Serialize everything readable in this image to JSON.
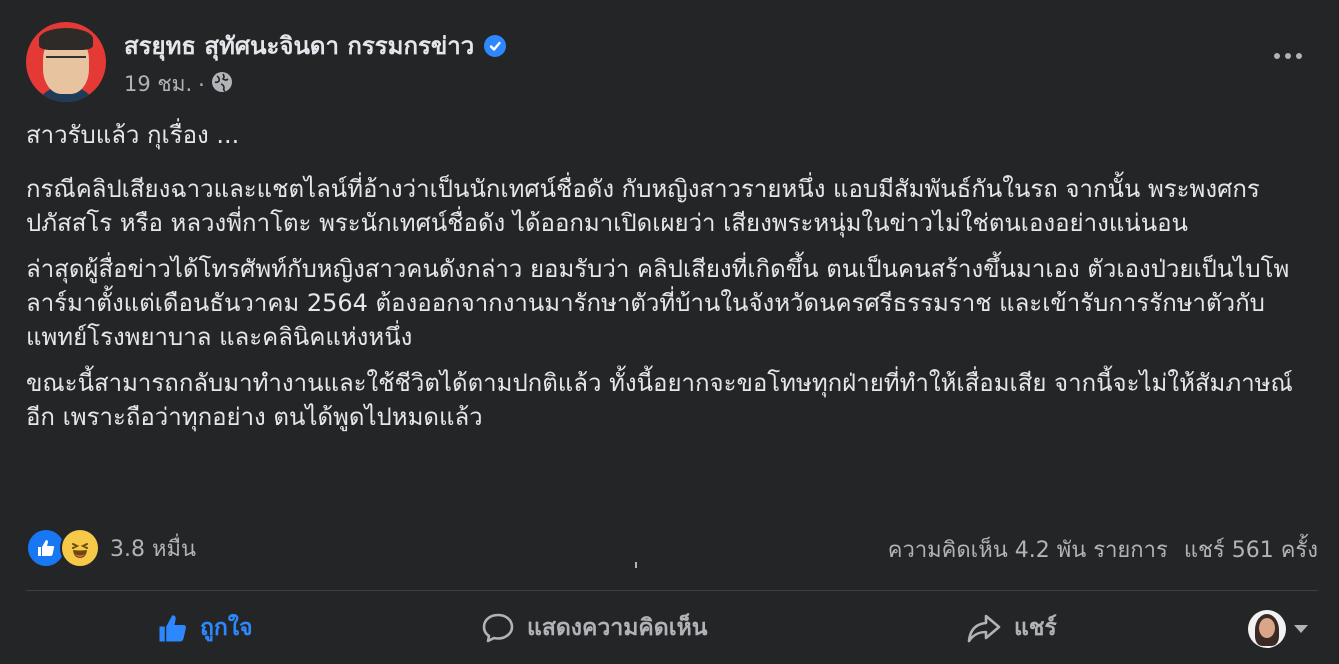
{
  "post": {
    "author": "สรยุทธ สุทัศนะจินดา กรรมกรข่าว",
    "time": "19 ชม.",
    "separator": "·",
    "paragraphs": [
      "สาวรับแล้ว กุเรื่อง ...",
      "กรณีคลิปเสียงฉาวและแชตไลน์ที่อ้างว่าเป็นนักเทศน์ชื่อดัง กับหญิงสาวรายหนึ่ง แอบมีสัมพันธ์กันในรถ จากนั้น พระพงศกร ปภัสสโร หรือ หลวงพี่กาโตะ พระนักเทศน์ชื่อดัง ได้ออกมาเปิดเผยว่า เสียงพระหนุ่มในข่าวไม่ใช่ตนเองอย่างแน่นอน",
      "ล่าสุดผู้สื่อข่าวได้โทรศัพท์กับหญิงสาวคนดังกล่าว ยอมรับว่า คลิปเสียงที่เกิดขึ้น ตนเป็นคนสร้างขึ้นมาเอง ตัวเองป่วยเป็นไบโพลาร์มาตั้งแต่เดือนธันวาคม 2564 ต้องออกจากงานมารักษาตัวที่บ้านในจังหวัดนครศรีธรรมราช และเข้ารับการรักษาตัวกับแพทย์โรงพยาบาล และคลินิคแห่งหนึ่ง",
      "ขณะนี้สามารถกลับมาทำงานและใช้ชีวิตได้ตามปกติแล้ว ทั้งนี้อยากจะขอโทษทุกฝ่ายที่ทำให้เสื่อมเสีย จากนี้จะไม่ให้สัมภาษณ์อีก เพราะถือว่าทุกอย่าง ตนได้พูดไปหมดแล้ว"
    ]
  },
  "stats": {
    "reactions_count": "3.8 หมื่น",
    "comments": "ความคิดเห็น 4.2 พัน รายการ",
    "shares": "แชร์ 561 ครั้ง"
  },
  "actions": {
    "like": "ถูกใจ",
    "comment": "แสดงความคิดเห็น",
    "share": "แชร์"
  },
  "icons": [
    "verified-badge-icon",
    "globe-icon",
    "more-options-icon",
    "like-reaction-icon",
    "haha-reaction-icon",
    "thumbs-up-icon",
    "comment-icon",
    "share-icon",
    "chevron-down-icon"
  ],
  "colors": {
    "background": "#242526",
    "text": "#e4e6eb",
    "secondary": "#b0b3b8",
    "accent": "#2d88ff"
  }
}
